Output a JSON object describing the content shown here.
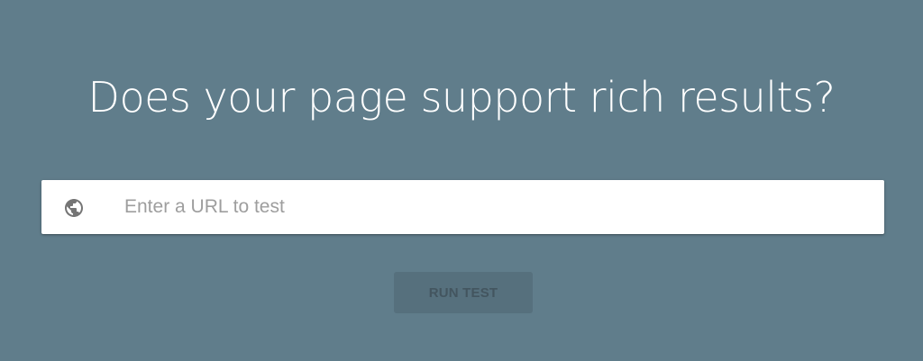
{
  "hero": {
    "headline": "Does your page support rich results?"
  },
  "url_input": {
    "icon": "globe-icon",
    "placeholder": "Enter a URL to test",
    "value": ""
  },
  "run_button": {
    "label": "RUN TEST",
    "state": "disabled"
  },
  "colors": {
    "background": "#607d8b",
    "input_background": "#ffffff",
    "placeholder_text": "#9e9e9e",
    "button_background": "#56707d",
    "button_text": "#43555f",
    "headline_text": "#ffffff",
    "icon": "#757575"
  }
}
